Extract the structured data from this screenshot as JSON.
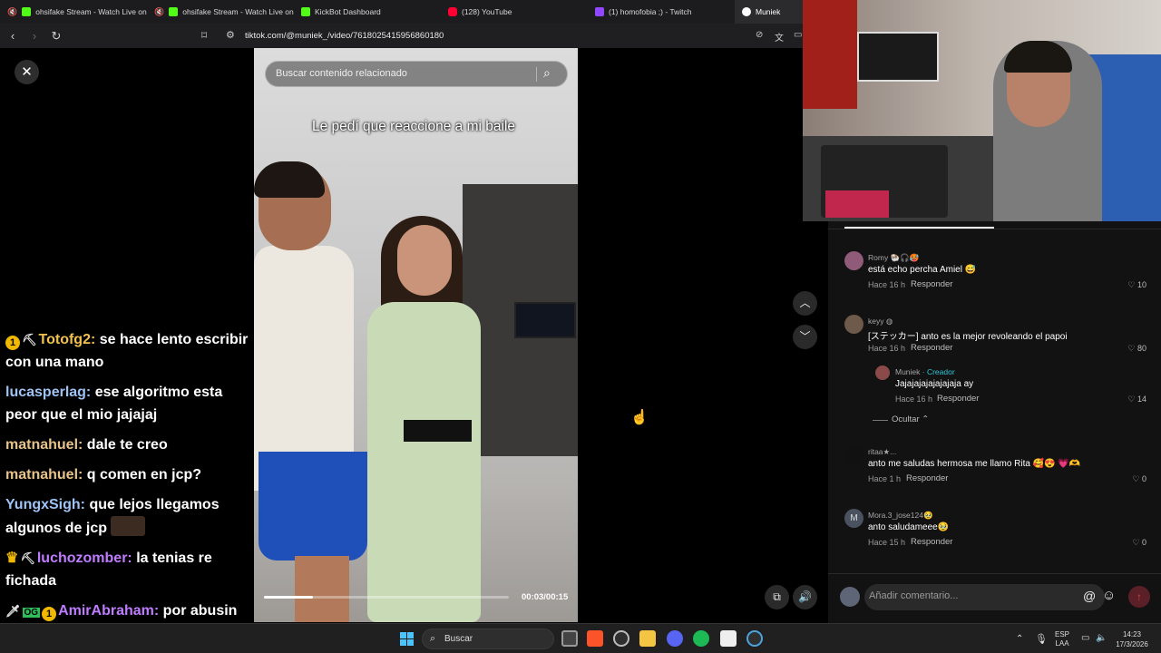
{
  "tabs": [
    {
      "title": "ohsifake Stream - Watch Live on",
      "icon": "kick-favicon"
    },
    {
      "title": "ohsifake Stream - Watch Live on",
      "icon": "kick-favicon"
    },
    {
      "title": "KickBot Dashboard",
      "icon": "kick-favicon"
    },
    {
      "title": "(128) YouTube",
      "icon": "youtube-favicon"
    },
    {
      "title": "(1) homofobia ;) - Twitch",
      "icon": "twitch-favicon"
    },
    {
      "title": "Muniek",
      "icon": "tiktok-favicon"
    }
  ],
  "address": {
    "url": "tiktok.com/@muniek_/video/7618025415956860180"
  },
  "chat": [
    {
      "user": "Totofg2:",
      "text": " se hace lento escribir con una mano",
      "color": "#f2c14e",
      "badges": [
        "1-badge",
        "pickaxe-badge"
      ]
    },
    {
      "user": "lucasperlag:",
      "text": " ese algoritmo esta peor que el mio jajajaj",
      "color": "#9ec3f5",
      "badges": []
    },
    {
      "user": "matnahuel:",
      "text": " dale te creo",
      "color": "#e8c48a",
      "badges": []
    },
    {
      "user": "matnahuel:",
      "text": " q comen en jcp?",
      "color": "#e8c48a",
      "badges": []
    },
    {
      "user": "YungxSigh:",
      "text": " que lejos llegamos algunos de jcp",
      "color": "#9ec3f5",
      "badges": []
    },
    {
      "user": "luchozomber:",
      "text": " la tenias re fichada",
      "color": "#c07cff",
      "badges": [
        "crown-badge",
        "pickaxe-badge"
      ]
    },
    {
      "user": "AmirAbraham:",
      "text": " por abusin te expulsaron",
      "color": "#c07cff",
      "badges": [
        "sword-badge",
        "og-badge",
        "1-badge"
      ]
    }
  ],
  "video": {
    "search_placeholder": "Buscar contenido relacionado",
    "caption": "Le pedí que reaccione a mi baile",
    "time": "00:03/00:15",
    "progress": 0.2
  },
  "comments": [
    {
      "user": "Romy",
      "user_suffix": " 🐏🎧🥵",
      "text": "está echo percha Amiel 😅",
      "meta": "Hace 16 h",
      "reply": "Responder",
      "likes": "10",
      "avatar_color": "#8f5b78"
    },
    {
      "user": "keyy",
      "user_suffix": " ◍",
      "text": "[ステッカー] anto es la mejor revoleando el papoi",
      "meta": "Hace 16 h",
      "reply": "Responder",
      "likes": "80",
      "avatar_color": "#6e5a4a"
    },
    {
      "user": "Muniek",
      "creator": " · Creador",
      "text": "Jajajajajajajajaja ay",
      "meta": "Hace 16 h",
      "reply": "Responder",
      "likes": "14",
      "avatar_color": "#8a4a4a"
    },
    {
      "user": "ritaa★...",
      "user_suffix": "",
      "text": "anto me saludas hermosa me llamo Rita 🥰😍 💗🫶",
      "meta": "Hace 1 h",
      "reply": "Responder",
      "likes": "0",
      "avatar_color": "#111"
    },
    {
      "user": "Mora.3_jose124",
      "user_suffix": "🥹",
      "text": "anto saludameee🥹",
      "meta": "Hace 15 h",
      "reply": "Responder",
      "likes": "0",
      "avatar_color": "#4a5260",
      "initial": "M"
    }
  ],
  "hide_label": "Ocultar",
  "comment_input": {
    "placeholder": "Añadir comentario..."
  },
  "taskbar": {
    "search": "Buscar",
    "lang1": "ESP",
    "lang2": "LAA",
    "time": "14:23",
    "date": "17/3/2026"
  }
}
